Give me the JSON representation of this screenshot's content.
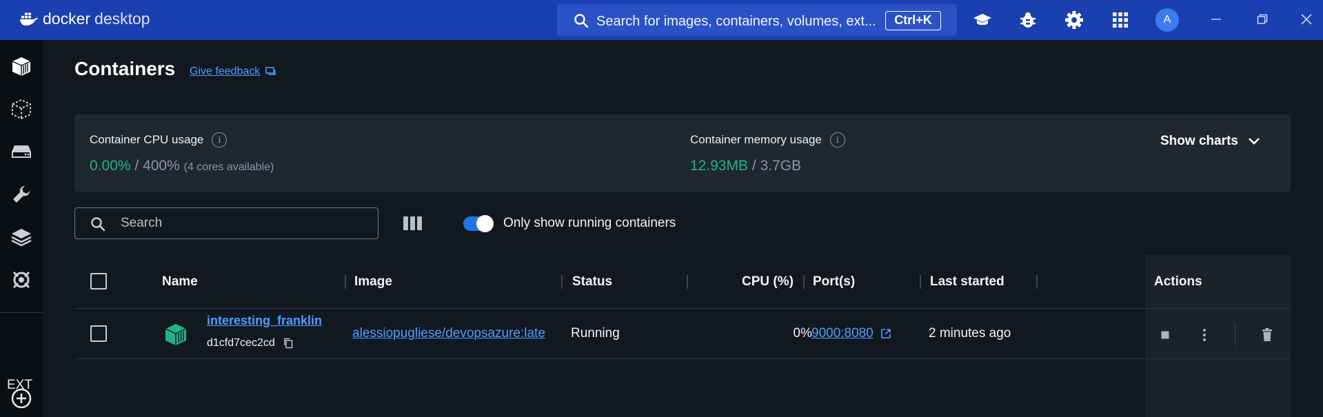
{
  "app": {
    "brand_bold": "docker",
    "brand_light": "desktop"
  },
  "topbar": {
    "search_text": "Search for images, containers, volumes, ext...",
    "shortcut": "Ctrl+K",
    "avatar_initial": "A"
  },
  "sidebar": {
    "ext_label": "EXT"
  },
  "page": {
    "title": "Containers",
    "feedback_label": "Give feedback"
  },
  "stats": {
    "cpu_label": "Container CPU usage",
    "cpu_used": "0.00%",
    "cpu_sep": " / ",
    "cpu_total": "400%",
    "cpu_note": "(4 cores available)",
    "mem_label": "Container memory usage",
    "mem_used": "12.93MB",
    "mem_sep": " / ",
    "mem_total": "3.7GB",
    "show_charts": "Show charts"
  },
  "filters": {
    "search_placeholder": "Search",
    "toggle_label": "Only show running containers",
    "toggle_on": true
  },
  "table": {
    "headers": {
      "name": "Name",
      "image": "Image",
      "status": "Status",
      "cpu": "CPU (%)",
      "ports": "Port(s)",
      "last_started": "Last started",
      "actions": "Actions"
    },
    "rows": [
      {
        "name": "interesting_franklin",
        "id": "d1cfd7cec2cd",
        "image": "alessiopugliese/devopsazure:late",
        "status": "Running",
        "cpu": "0%",
        "ports": "9000:8080",
        "last_started": "2 minutes ago"
      }
    ]
  },
  "colors": {
    "titlebar": "#1a3fb0",
    "accent": "#4f9dff",
    "green": "#21b28f",
    "background": "#121820"
  }
}
